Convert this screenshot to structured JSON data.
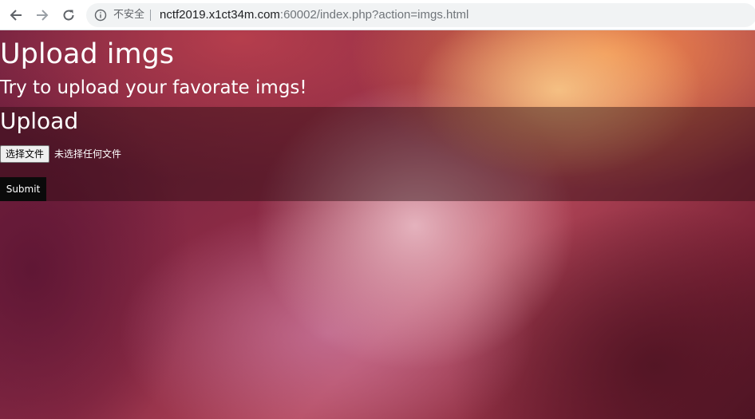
{
  "browser": {
    "security_label": "不安全",
    "url_host": "nctf2019.x1ct34m.com",
    "url_rest": ":60002/index.php?action=imgs.html",
    "icons": {
      "back": "back-arrow-icon",
      "forward": "forward-arrow-icon",
      "reload": "reload-icon",
      "info": "info-icon"
    }
  },
  "page": {
    "title": "Upload imgs",
    "subtitle": "Try to upload your favorate imgs!",
    "upload": {
      "heading": "Upload",
      "file_button_label": "选择文件",
      "file_status": "未选择任何文件",
      "submit_label": "Submit"
    }
  },
  "colors": {
    "panel_overlay": "#280a0f",
    "submit_bg": "#0a0a0a",
    "text": "#ffffff"
  }
}
